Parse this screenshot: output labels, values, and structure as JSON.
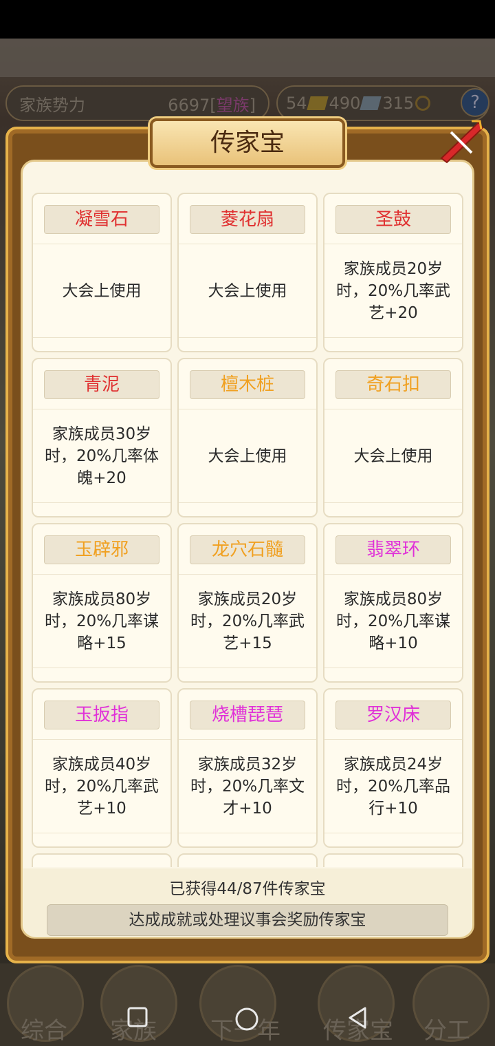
{
  "header": {
    "power_label": "家族势力",
    "power_value": "6697",
    "power_rank_open": "[",
    "power_rank": "望族",
    "power_rank_close": "]",
    "gold": "54",
    "silver": "490",
    "coins": "315",
    "help": "?"
  },
  "dialog": {
    "title": "传家宝",
    "items": [
      {
        "name": "凝雪石",
        "desc": "大会上使用",
        "color": "#e03030"
      },
      {
        "name": "菱花扇",
        "desc": "大会上使用",
        "color": "#e03030"
      },
      {
        "name": "圣鼓",
        "desc": "家族成员20岁时，20%几率武艺+20",
        "color": "#e03030"
      },
      {
        "name": "青泥",
        "desc": "家族成员30岁时，20%几率体魄+20",
        "color": "#e03030"
      },
      {
        "name": "檀木桩",
        "desc": "大会上使用",
        "color": "#f0a020"
      },
      {
        "name": "奇石扣",
        "desc": "大会上使用",
        "color": "#f0a020"
      },
      {
        "name": "玉辟邪",
        "desc": "家族成员80岁时，20%几率谋略+15",
        "color": "#f0a020"
      },
      {
        "name": "龙穴石髓",
        "desc": "家族成员20岁时，20%几率武艺+15",
        "color": "#f0a020"
      },
      {
        "name": "翡翠环",
        "desc": "家族成员80岁时，20%几率谋略+10",
        "color": "#e030d8"
      },
      {
        "name": "玉扳指",
        "desc": "家族成员40岁时，20%几率武艺+10",
        "color": "#e030d8"
      },
      {
        "name": "烧槽琵琶",
        "desc": "家族成员32岁时，20%几率文才+10",
        "color": "#e030d8"
      },
      {
        "name": "罗汉床",
        "desc": "家族成员24岁时，20%几率品行+10",
        "color": "#e030d8"
      }
    ],
    "count_text": "已获得44/87件传家宝",
    "hint_text": "达成成就或处理议事会奖励传家宝"
  },
  "bottom_nav": {
    "items": [
      "综合",
      "家族",
      "下一年",
      "传家宝",
      "分工"
    ]
  }
}
